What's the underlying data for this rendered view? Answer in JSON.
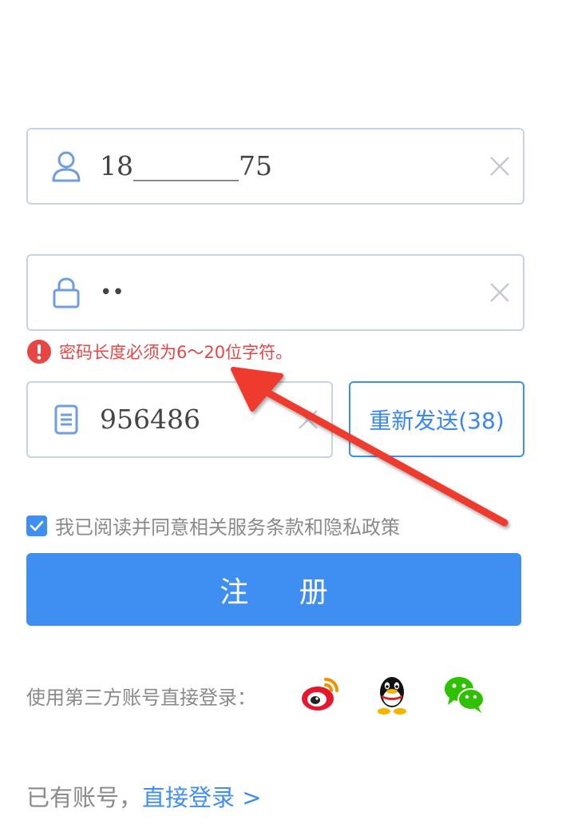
{
  "phone": {
    "value": "18________75"
  },
  "password": {
    "value": "••"
  },
  "error": {
    "message": "密码长度必须为6～20位字符。"
  },
  "code": {
    "value": "956486"
  },
  "resend": {
    "label": "重新发送(38)"
  },
  "agreement": {
    "text": "我已阅读并同意相关服务条款和隐私政策",
    "checked": true
  },
  "register": {
    "label": "注 册"
  },
  "third_party": {
    "label": "使用第三方账号直接登录：",
    "providers": [
      "weibo-icon",
      "qq-icon",
      "wechat-icon"
    ]
  },
  "login": {
    "prefix": "已有账号，",
    "link": "直接登录 >"
  },
  "colors": {
    "accent": "#3f8ef2",
    "error": "#e84545",
    "border": "#c8d3e3",
    "muted_text": "#8a8a8a",
    "annotation_arrow": "#ef3b2d"
  }
}
